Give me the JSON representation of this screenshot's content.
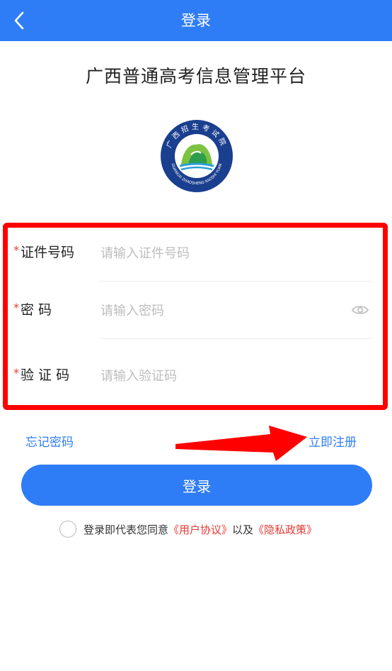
{
  "nav": {
    "title": "登录"
  },
  "app_title": "广西普通高考信息管理平台",
  "logo": {
    "ring_text": "广西招生考试院",
    "sub_text": "GUANGXI ZHAOSHENG KAOSHI YUAN"
  },
  "form": {
    "id_label": "证件号码",
    "id_placeholder": "请输入证件号码",
    "pwd_label": "密 码",
    "pwd_placeholder": "请输入密码",
    "captcha_label": "验 证 码",
    "captcha_placeholder": "请输入验证码",
    "required_mark": "*"
  },
  "links": {
    "forgot": "忘记密码",
    "register": "立即注册"
  },
  "login_button": "登录",
  "agreement": {
    "prefix": "登录即代表您同意",
    "user_agreement": "《用户协议》",
    "middle": "以及",
    "privacy_policy": "《隐私政策》"
  },
  "colors": {
    "primary": "#2f7df6",
    "highlight_red": "#ff0000",
    "required_red": "#e53935"
  }
}
